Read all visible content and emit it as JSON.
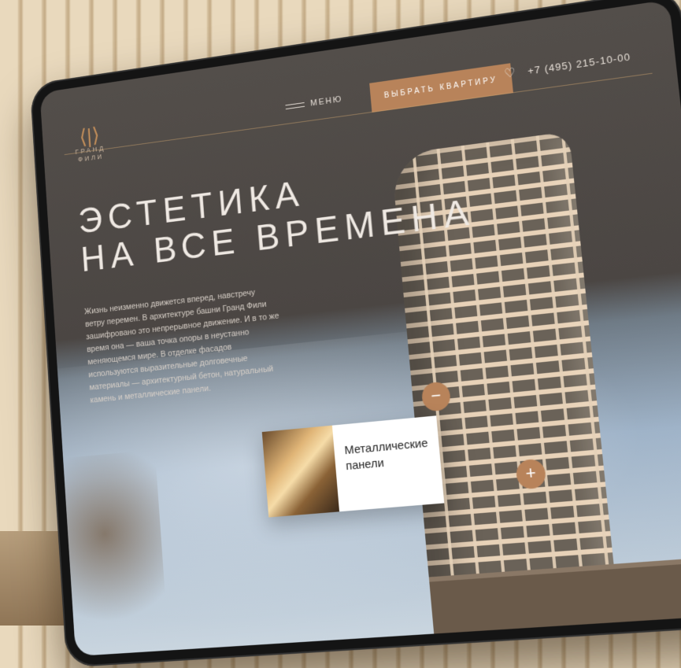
{
  "header": {
    "logo_text_top": "Гранд",
    "logo_text_bottom": "Фили",
    "menu_label": "МЕНЮ",
    "cta_label": "ВЫБРАТЬ КВАРТИРУ",
    "phone": "+7 (495) 215-10-00"
  },
  "hero": {
    "title_line1": "ЭСТЕТИКА",
    "title_line2": "НА ВСЕ ВРЕМЕНА",
    "description": "Жизнь неизменно движется вперед, навстречу ветру перемен. В архитектуре башни Гранд Фили зашифровано это непрерывное движение. И в то же время она — ваша точка опоры в неустанно меняющемся мире. В отделке фасадов используются выразительные долговечные материалы — архитектурный бетон, натуральный камень и металлические панели."
  },
  "card": {
    "title": "Металлические панели"
  },
  "controls": {
    "minus_symbol": "−",
    "plus_symbol": "+"
  },
  "icons": {
    "menu": "menu-lines-icon",
    "favorite": "heart-icon",
    "logo": "grand-fili-logo"
  },
  "colors": {
    "accent": "#b8835a",
    "screen_bg": "#4b4643"
  }
}
